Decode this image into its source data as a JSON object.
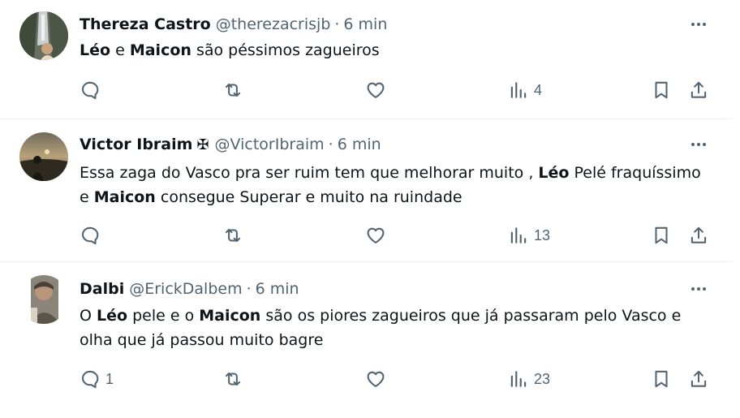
{
  "tweets": [
    {
      "name": "Thereza Castro",
      "badge": "",
      "handle": "@therezacrisjb",
      "separator": "·",
      "time": "6 min",
      "body": [
        {
          "bold": "Léo"
        },
        {
          "text": " e "
        },
        {
          "bold": "Maicon"
        },
        {
          "text": " são péssimos zagueiros"
        }
      ],
      "replies": "",
      "views": "4"
    },
    {
      "name": "Victor Ibraim",
      "badge": "✠",
      "handle": "@VictorIbraim",
      "separator": "·",
      "time": "6 min",
      "body": [
        {
          "text": "Essa zaga do Vasco pra ser ruim tem que melhorar muito , "
        },
        {
          "bold": "Léo"
        },
        {
          "text": " Pelé fraquíssimo e "
        },
        {
          "bold": "Maicon"
        },
        {
          "text": " consegue Superar e muito na ruindade"
        }
      ],
      "replies": "",
      "views": "13"
    },
    {
      "name": "Dalbi",
      "badge": "",
      "handle": "@ErickDalbem",
      "separator": "·",
      "time": "6 min",
      "body": [
        {
          "text": "O "
        },
        {
          "bold": "Léo"
        },
        {
          "text": " pele e o "
        },
        {
          "bold": "Maicon"
        },
        {
          "text": " são os  piores zagueiros que já passaram pelo Vasco e olha que já passou muito bagre"
        }
      ],
      "replies": "1",
      "views": "23"
    }
  ],
  "icons": {
    "more": "more-horizontal-icon",
    "reply": "reply-bubble-icon",
    "retweet": "retweet-icon",
    "like": "heart-icon",
    "views": "bar-chart-icon",
    "bookmark": "bookmark-icon",
    "share": "share-icon"
  },
  "colors": {
    "text": "#0f1419",
    "secondary": "#536471",
    "divider": "#eff3f4"
  }
}
